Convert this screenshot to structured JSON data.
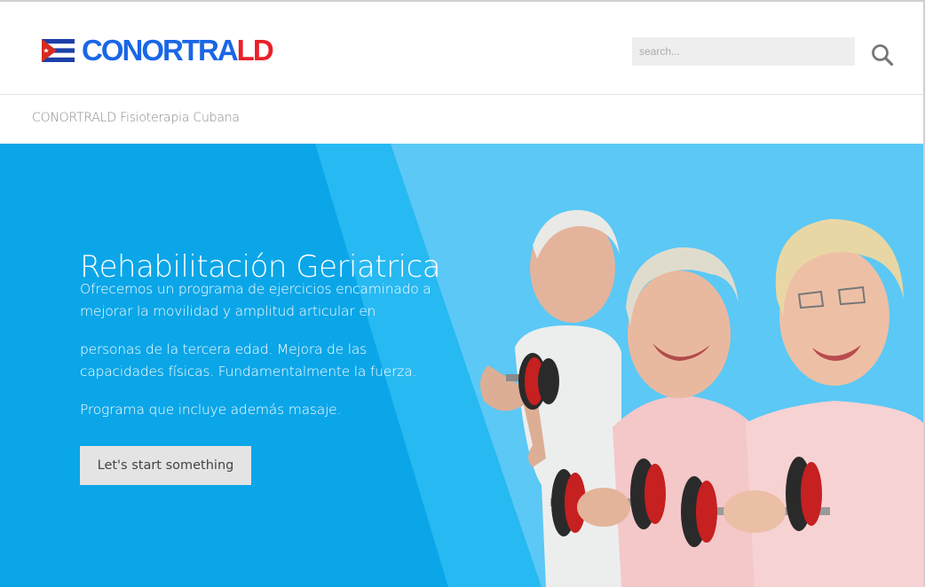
{
  "header": {
    "logo": {
      "text_main": "CONORTRA",
      "text_accent": "LD",
      "main_color": "#1a66e6",
      "accent_color": "#e8202a"
    },
    "search": {
      "placeholder": "search...",
      "value": "",
      "icon": "magnifier-icon"
    }
  },
  "breadcrumb": {
    "text": "CONORTRALD Fisioterapia Cubana"
  },
  "hero": {
    "title": "Rehabilitación Geriatrica",
    "paragraphs": [
      "Ofrecemos un programa de ejercicios encaminado a mejorar la movilidad y amplitud articular en",
      "personas de la tercera edad. Mejora de las capacidades físicas. Fundamentalmente la fuerza.",
      "Programa que incluye además masaje."
    ],
    "cta_label": "Let's start something",
    "colors": {
      "dark_blue": "#0aa6e8",
      "mid_blue": "#27b9f2",
      "light_blue": "#5bc8f5",
      "button_bg": "#e4e4e4"
    }
  }
}
